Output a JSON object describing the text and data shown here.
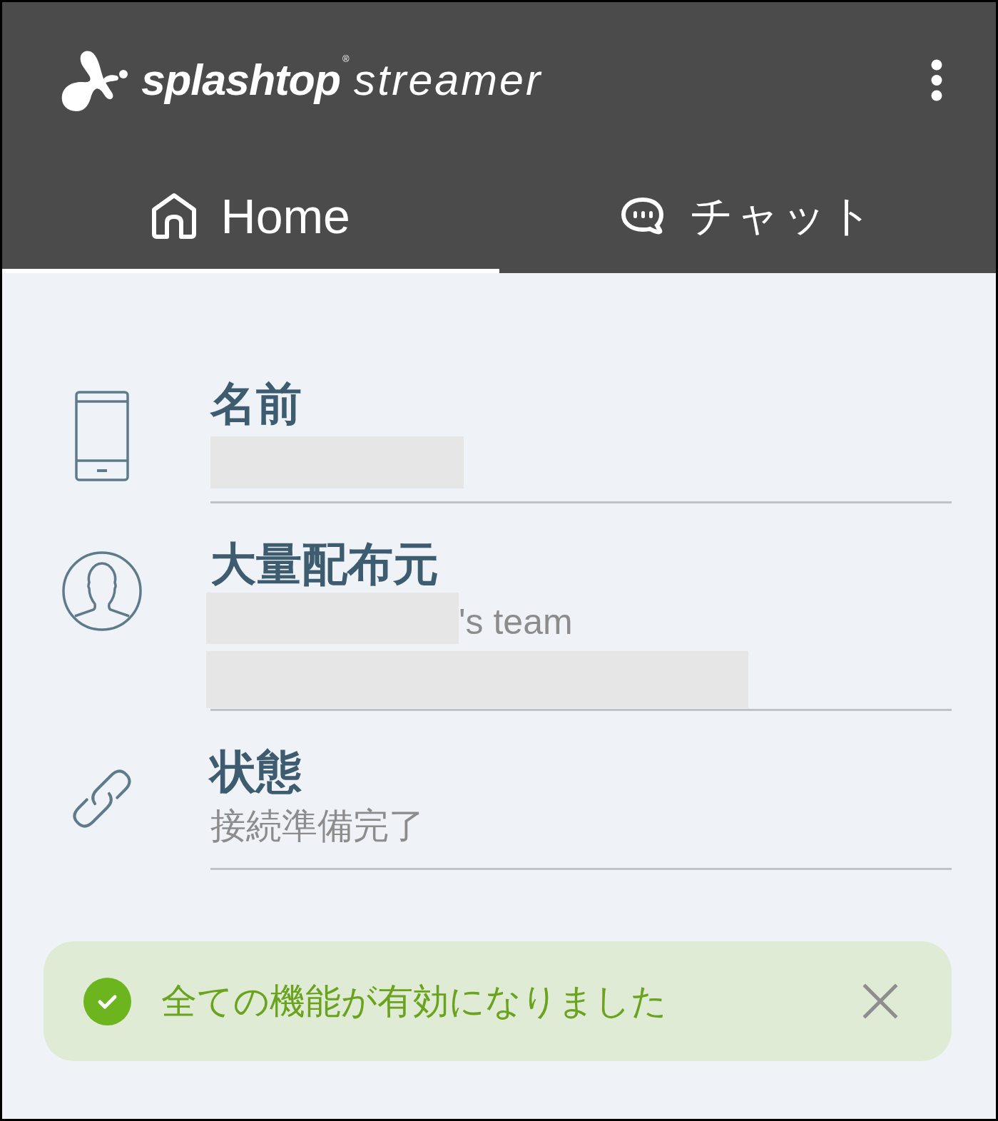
{
  "header": {
    "logo": {
      "brand": "splashtop",
      "registered": "®",
      "product": "streamer"
    }
  },
  "tabs": [
    {
      "label": "Home",
      "selected": true
    },
    {
      "label": "チャット",
      "selected": false
    }
  ],
  "info_rows": [
    {
      "label": "名前",
      "lines": [
        {
          "kind": "redacted"
        }
      ]
    },
    {
      "label": "大量配布元",
      "lines": [
        {
          "kind": "redacted_text",
          "text": "'s team"
        },
        {
          "kind": "redacted"
        }
      ]
    },
    {
      "label": "状態",
      "lines": [
        {
          "kind": "text",
          "text": "接続準備完了"
        }
      ]
    }
  ],
  "notification": {
    "kind": "success",
    "message": "全ての機能が有効になりました"
  }
}
